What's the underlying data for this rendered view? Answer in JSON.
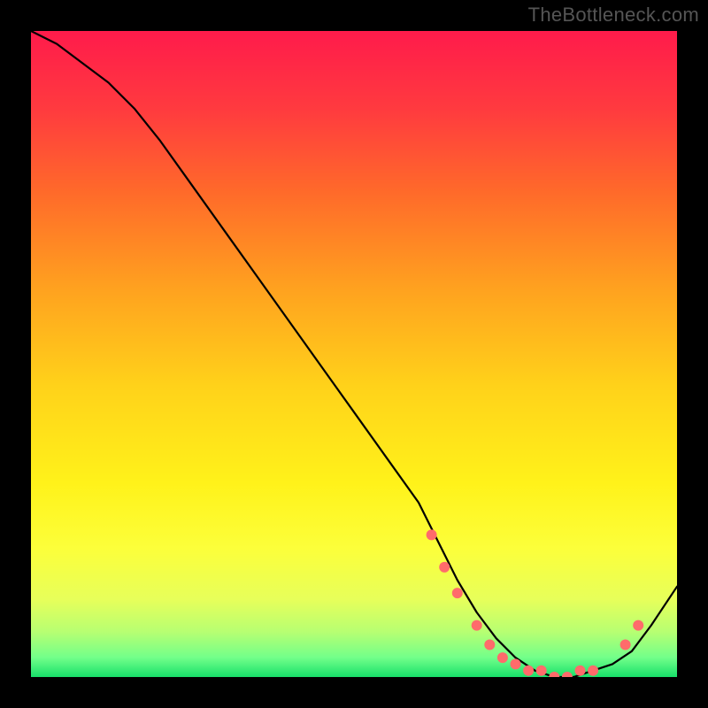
{
  "watermark": "TheBottleneck.com",
  "chart_data": {
    "type": "line",
    "title": "",
    "xlabel": "",
    "ylabel": "",
    "xlim": [
      0,
      100
    ],
    "ylim": [
      0,
      100
    ],
    "grid": false,
    "description": "Bottleneck percentage curve over a vertical rainbow gradient background. The curve descends from top-left, reaches a minimum plateau near x≈70–90, then rises slightly. Scatter points mark the region around the minimum.",
    "gradient_stops": [
      {
        "offset": 0.0,
        "color": "#ff1b4b"
      },
      {
        "offset": 0.12,
        "color": "#ff3a3f"
      },
      {
        "offset": 0.25,
        "color": "#ff6a2a"
      },
      {
        "offset": 0.4,
        "color": "#ffa21f"
      },
      {
        "offset": 0.55,
        "color": "#ffd21a"
      },
      {
        "offset": 0.7,
        "color": "#fff21a"
      },
      {
        "offset": 0.8,
        "color": "#fcff3a"
      },
      {
        "offset": 0.88,
        "color": "#e7ff5a"
      },
      {
        "offset": 0.93,
        "color": "#b7ff72"
      },
      {
        "offset": 0.97,
        "color": "#72ff8a"
      },
      {
        "offset": 1.0,
        "color": "#18e06a"
      }
    ],
    "series": [
      {
        "name": "bottleneck-curve",
        "x": [
          0,
          4,
          8,
          12,
          16,
          20,
          25,
          30,
          35,
          40,
          45,
          50,
          55,
          60,
          63,
          66,
          69,
          72,
          75,
          78,
          81,
          84,
          87,
          90,
          93,
          96,
          100
        ],
        "y": [
          100,
          98,
          95,
          92,
          88,
          83,
          76,
          69,
          62,
          55,
          48,
          41,
          34,
          27,
          21,
          15,
          10,
          6,
          3,
          1,
          0,
          0,
          1,
          2,
          4,
          8,
          14
        ]
      }
    ],
    "scatter": {
      "name": "highlight-points",
      "color": "#ff6b6b",
      "points": [
        {
          "x": 62,
          "y": 22
        },
        {
          "x": 64,
          "y": 17
        },
        {
          "x": 66,
          "y": 13
        },
        {
          "x": 69,
          "y": 8
        },
        {
          "x": 71,
          "y": 5
        },
        {
          "x": 73,
          "y": 3
        },
        {
          "x": 75,
          "y": 2
        },
        {
          "x": 77,
          "y": 1
        },
        {
          "x": 79,
          "y": 1
        },
        {
          "x": 81,
          "y": 0
        },
        {
          "x": 83,
          "y": 0
        },
        {
          "x": 85,
          "y": 1
        },
        {
          "x": 87,
          "y": 1
        },
        {
          "x": 92,
          "y": 5
        },
        {
          "x": 94,
          "y": 8
        }
      ]
    }
  }
}
